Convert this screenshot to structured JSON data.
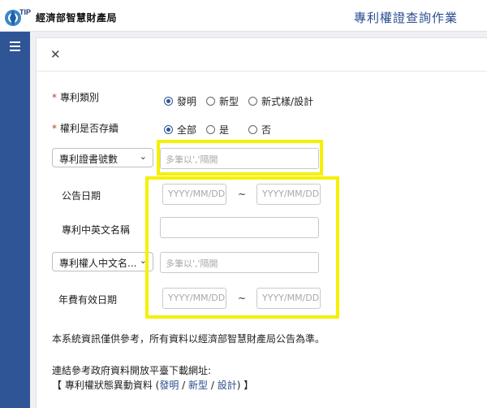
{
  "header": {
    "org_name": "經濟部智慧財產局",
    "page_title": "專利權證查詢作業",
    "logo_text": "TIPO"
  },
  "form": {
    "category": {
      "label": "專利類別",
      "options": [
        "發明",
        "新型",
        "新式樣/設計"
      ],
      "selected": "發明"
    },
    "alive": {
      "label": "權利是否存續",
      "options": [
        "全部",
        "是",
        "否"
      ],
      "selected": "全部"
    },
    "cert_select": {
      "value": "專利證書號數"
    },
    "cert_input": {
      "placeholder": "多筆以','隔開"
    },
    "announce_date": {
      "label": "公告日期",
      "from_placeholder": "YYYY/MM/DD",
      "to_placeholder": "YYYY/MM/DD",
      "separator": "~"
    },
    "name": {
      "label": "專利中英文名稱",
      "value": ""
    },
    "owner_select": {
      "value": "專利權人中文名..."
    },
    "owner_input": {
      "placeholder": "多筆以','隔開"
    },
    "fee_date": {
      "label": "年費有效日期",
      "from_placeholder": "YYYY/MM/DD",
      "to_placeholder": "YYYY/MM/DD",
      "separator": "~"
    }
  },
  "footer": {
    "note": "本系統資訊僅供參考，所有資料以經濟部智慧財產局公告為準。",
    "link_intro": "連結參考政府資料開放平臺下載網址:",
    "link_prefix": "【 專利權狀態異動資料 (",
    "links": [
      "發明",
      "新型",
      "設計"
    ],
    "link_sep": " / ",
    "link_suffix": ") 】"
  },
  "colors": {
    "sidebar": "#2f5597",
    "highlight": "#f6f000",
    "required_star": "#c0392b"
  },
  "icons": {
    "menu": "hamburger-icon",
    "close": "close-icon",
    "chevron": "chevron-down-icon"
  }
}
